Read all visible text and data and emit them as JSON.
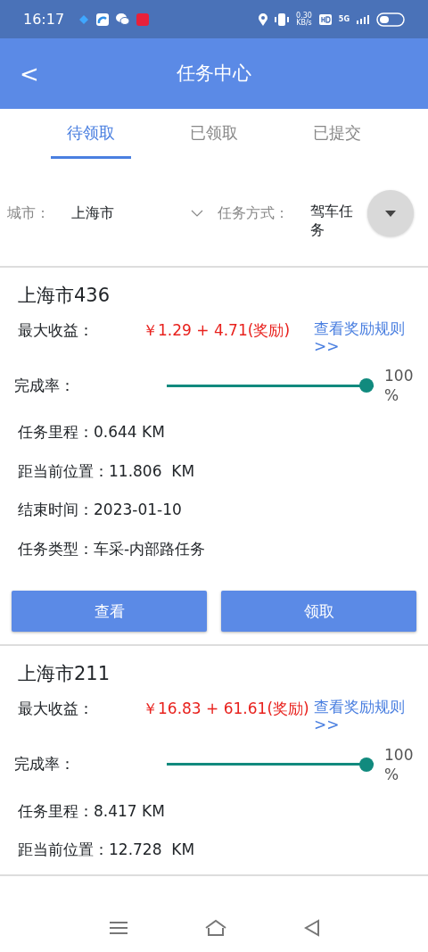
{
  "status_bar": {
    "time": "16:17",
    "speed": "0.30",
    "speed_unit": "KB/s",
    "network": "5G"
  },
  "header": {
    "back": "<",
    "title": "任务中心"
  },
  "tabs": [
    {
      "label": "待领取",
      "selected": true
    },
    {
      "label": "已领取",
      "selected": false
    },
    {
      "label": "已提交",
      "selected": false
    }
  ],
  "filters": {
    "city_label": "城市：",
    "city_value": "上海市",
    "mode_label": "任务方式：",
    "mode_value": "驾车任务"
  },
  "tasks": [
    {
      "title": "上海市436",
      "reward_label": "最大收益：",
      "reward": "￥1.29 + 4.71(奖励)",
      "rule_link": "查看奖励规则>>",
      "completion_label": "完成率：",
      "level": 1,
      "reading": "100 %",
      "details": [
        {
          "label": "任务里程：",
          "value": "0.644 KM"
        },
        {
          "label": "距当前位置：",
          "value": "11.806  KM"
        },
        {
          "label": "结束时间：",
          "value": "2023-01-10"
        },
        {
          "label": "任务类型：",
          "value": "车采-内部路任务"
        }
      ],
      "buttons": [
        "查看",
        "领取"
      ]
    },
    {
      "title": "上海市211",
      "reward_label": "最大收益：",
      "reward": "￥16.83 + 61.61(奖励)",
      "rule_link": "查看奖励规则>>",
      "completion_label": "完成率：",
      "level": 1,
      "reading": "100 %",
      "details": [
        {
          "label": "任务里程：",
          "value": "8.417 KM"
        },
        {
          "label": "距当前位置：",
          "value": "12.728  KM"
        }
      ]
    }
  ]
}
